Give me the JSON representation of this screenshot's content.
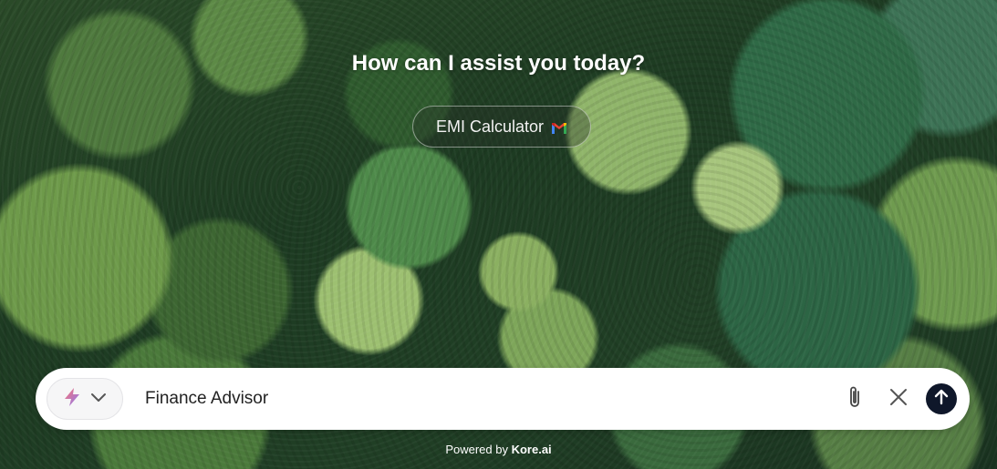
{
  "heading": "How can I assist you today?",
  "suggestion_chip": {
    "label": "EMI Calculator",
    "icon": "gmail-icon"
  },
  "composer": {
    "agent_icon": "lightning-icon",
    "dropdown_icon": "chevron-down-icon",
    "input_value": "Finance Advisor",
    "attach_icon": "paperclip-icon",
    "clear_icon": "close-icon",
    "send_icon": "arrow-up-icon"
  },
  "footer": {
    "prefix": "Powered by",
    "brand": "Kore.ai"
  },
  "colors": {
    "send_button": "#0f172a",
    "lightning_start": "#f97373",
    "lightning_end": "#8b7cf6"
  }
}
